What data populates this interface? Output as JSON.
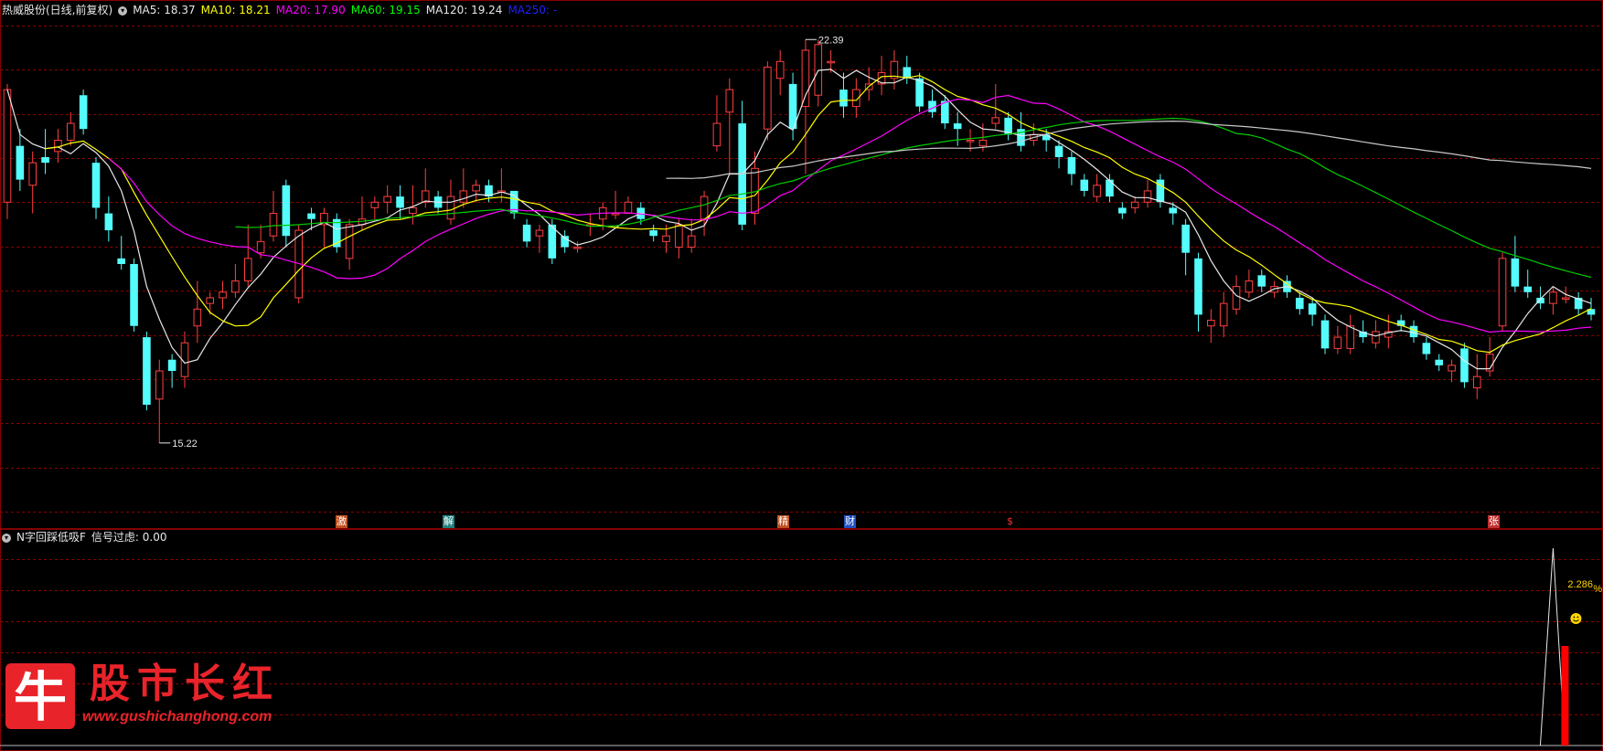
{
  "header": {
    "title": "热威股份(日线,前复权)",
    "ma_labels": [
      {
        "text": "MA5: 18.37",
        "color": "#e8e8e8"
      },
      {
        "text": "MA10: 18.21",
        "color": "#ffff00"
      },
      {
        "text": "MA20: 17.90",
        "color": "#ff00ff"
      },
      {
        "text": "MA60: 19.15",
        "color": "#00ff00"
      },
      {
        "text": "MA120: 19.24",
        "color": "#e8e8e8"
      },
      {
        "text": "MA250: -",
        "color": "#2020ff"
      }
    ]
  },
  "sub_header": {
    "indicator": "N字回踩低吸F",
    "signal_label": "信号过虑: 0.00"
  },
  "markers": {
    "high_price": "22.39",
    "low_price": "15.22",
    "indicator_value": "2.286",
    "indicator_unit": "%"
  },
  "event_tags": [
    {
      "text": "激",
      "bg": "#c05020",
      "color": "#ffffff"
    },
    {
      "text": "解",
      "bg": "#208080",
      "color": "#ffffff"
    },
    {
      "text": "精",
      "bg": "#c05020",
      "color": "#ffffff"
    },
    {
      "text": "财",
      "bg": "#2050c0",
      "color": "#ffffff"
    },
    {
      "text": "$",
      "bg": "#000000",
      "color": "#ff3030"
    },
    {
      "text": "张",
      "bg": "#c03030",
      "color": "#ffffff"
    }
  ],
  "logo": {
    "char": "牛",
    "title": "股市长红",
    "url": "www.gushichanghong.com"
  },
  "colors": {
    "up": "#ff4040",
    "down": "#54fcfc",
    "grid": "#8a0000",
    "ma5": "#e8e8e8",
    "ma10": "#ffff00",
    "ma20": "#ff00ff",
    "ma60": "#00cc00",
    "ma120": "#c8c8c8"
  },
  "chart_data": {
    "type": "candlestick",
    "price_range": [
      15.22,
      22.39
    ],
    "candles": [
      [
        19.5,
        21.5,
        21.6,
        19.2
      ],
      [
        20.5,
        19.9,
        20.8,
        19.7
      ],
      [
        19.8,
        20.2,
        20.4,
        19.3
      ],
      [
        20.3,
        20.2,
        20.8,
        20.0
      ],
      [
        20.4,
        20.6,
        20.8,
        20.2
      ],
      [
        20.6,
        20.9,
        21.1,
        20.5
      ],
      [
        21.4,
        20.8,
        21.5,
        20.7
      ],
      [
        20.2,
        19.4,
        20.3,
        19.2
      ],
      [
        19.3,
        19.0,
        19.6,
        18.8
      ],
      [
        18.5,
        18.4,
        18.9,
        18.3
      ],
      [
        18.4,
        17.3,
        18.5,
        17.2
      ],
      [
        17.1,
        15.9,
        17.2,
        15.8
      ],
      [
        16.0,
        16.5,
        16.7,
        15.22
      ],
      [
        16.7,
        16.5,
        16.8,
        16.2
      ],
      [
        16.4,
        17.0,
        17.2,
        16.2
      ],
      [
        17.3,
        17.6,
        18.1,
        17.0
      ],
      [
        17.7,
        17.8,
        17.9,
        17.5
      ],
      [
        17.8,
        17.9,
        18.1,
        17.6
      ],
      [
        17.9,
        18.1,
        18.4,
        17.8
      ],
      [
        18.1,
        18.5,
        19.1,
        18.0
      ],
      [
        18.6,
        18.8,
        19.1,
        18.5
      ],
      [
        18.9,
        19.3,
        19.7,
        18.8
      ],
      [
        19.8,
        18.9,
        19.9,
        18.7
      ],
      [
        17.8,
        19.0,
        19.1,
        17.7
      ],
      [
        19.3,
        19.2,
        19.4,
        19.0
      ],
      [
        19.1,
        19.3,
        19.4,
        18.7
      ],
      [
        19.2,
        18.7,
        19.3,
        18.6
      ],
      [
        18.5,
        19.1,
        19.2,
        18.3
      ],
      [
        19.1,
        19.2,
        19.6,
        19.0
      ],
      [
        19.4,
        19.5,
        19.6,
        19.2
      ],
      [
        19.5,
        19.6,
        19.8,
        19.3
      ],
      [
        19.6,
        19.4,
        19.8,
        19.2
      ],
      [
        19.3,
        19.4,
        19.8,
        19.1
      ],
      [
        19.5,
        19.7,
        20.1,
        19.4
      ],
      [
        19.6,
        19.4,
        19.7,
        19.3
      ],
      [
        19.2,
        19.6,
        19.9,
        19.1
      ],
      [
        19.5,
        19.7,
        20.1,
        19.4
      ],
      [
        19.7,
        19.8,
        19.9,
        19.5
      ],
      [
        19.8,
        19.6,
        19.9,
        19.5
      ],
      [
        19.7,
        19.7,
        20.1,
        19.5
      ],
      [
        19.7,
        19.3,
        19.7,
        19.2
      ],
      [
        19.1,
        18.8,
        19.2,
        18.7
      ],
      [
        18.9,
        19.0,
        19.1,
        18.6
      ],
      [
        19.1,
        18.5,
        19.2,
        18.4
      ],
      [
        18.9,
        18.7,
        19.0,
        18.6
      ],
      [
        18.7,
        18.7,
        18.8,
        18.6
      ],
      [
        19.1,
        19.1,
        19.3,
        18.9
      ],
      [
        19.2,
        19.4,
        19.5,
        19.0
      ],
      [
        19.3,
        19.3,
        19.7,
        19.2
      ],
      [
        19.3,
        19.5,
        19.6,
        19.3
      ],
      [
        19.4,
        19.2,
        19.5,
        19.1
      ],
      [
        19.0,
        18.9,
        19.1,
        18.8
      ],
      [
        18.8,
        18.9,
        19.1,
        18.6
      ],
      [
        18.7,
        19.1,
        19.2,
        18.5
      ],
      [
        18.7,
        18.9,
        19.2,
        18.6
      ],
      [
        19.2,
        19.6,
        19.7,
        18.9
      ],
      [
        20.5,
        20.9,
        21.4,
        20.4
      ],
      [
        21.1,
        21.5,
        21.7,
        20.0
      ],
      [
        20.9,
        19.1,
        21.3,
        19.0
      ],
      [
        19.3,
        20.1,
        20.4,
        19.1
      ],
      [
        20.8,
        21.9,
        22.0,
        20.6
      ],
      [
        21.7,
        22.0,
        22.2,
        21.4
      ],
      [
        21.6,
        20.8,
        21.8,
        20.6
      ],
      [
        21.2,
        22.2,
        22.39,
        20.0
      ],
      [
        21.4,
        22.3,
        22.39,
        21.2
      ],
      [
        22.0,
        22.0,
        22.2,
        21.8
      ],
      [
        21.5,
        21.2,
        21.8,
        21.0
      ],
      [
        21.2,
        21.5,
        21.7,
        21.0
      ],
      [
        21.5,
        21.6,
        21.9,
        21.3
      ],
      [
        21.6,
        21.8,
        22.1,
        21.4
      ],
      [
        21.7,
        22.0,
        22.2,
        21.5
      ],
      [
        21.9,
        21.7,
        22.1,
        21.6
      ],
      [
        21.7,
        21.2,
        21.8,
        21.1
      ],
      [
        21.3,
        21.1,
        21.5,
        21.0
      ],
      [
        21.3,
        20.9,
        21.4,
        20.8
      ],
      [
        20.9,
        20.8,
        21.1,
        20.5
      ],
      [
        20.6,
        20.6,
        20.8,
        20.4
      ],
      [
        20.5,
        20.6,
        20.9,
        20.4
      ],
      [
        20.9,
        21.0,
        21.6,
        20.8
      ],
      [
        21.0,
        20.7,
        21.1,
        20.6
      ],
      [
        20.8,
        20.5,
        21.1,
        20.4
      ],
      [
        20.6,
        20.7,
        20.9,
        20.5
      ],
      [
        20.7,
        20.6,
        20.8,
        20.4
      ],
      [
        20.5,
        20.3,
        20.6,
        20.1
      ],
      [
        20.3,
        20.0,
        20.4,
        19.8
      ],
      [
        19.9,
        19.7,
        20.0,
        19.6
      ],
      [
        19.6,
        19.8,
        20.0,
        19.5
      ],
      [
        19.9,
        19.6,
        20.0,
        19.5
      ],
      [
        19.4,
        19.3,
        19.5,
        19.2
      ],
      [
        19.4,
        19.5,
        19.6,
        19.3
      ],
      [
        19.5,
        19.7,
        19.9,
        19.4
      ],
      [
        19.9,
        19.5,
        20.0,
        19.4
      ],
      [
        19.4,
        19.3,
        19.5,
        19.1
      ],
      [
        19.1,
        18.6,
        19.2,
        18.2
      ],
      [
        18.5,
        17.5,
        18.6,
        17.2
      ],
      [
        17.3,
        17.4,
        17.6,
        17.0
      ],
      [
        17.3,
        17.7,
        17.9,
        17.1
      ],
      [
        17.6,
        18.0,
        18.2,
        17.5
      ],
      [
        17.9,
        18.1,
        18.3,
        17.8
      ],
      [
        18.2,
        18.0,
        18.3,
        17.9
      ],
      [
        17.9,
        18.0,
        18.1,
        17.8
      ],
      [
        18.1,
        17.9,
        18.2,
        17.8
      ],
      [
        17.8,
        17.6,
        17.9,
        17.5
      ],
      [
        17.7,
        17.5,
        17.8,
        17.3
      ],
      [
        17.4,
        16.9,
        17.5,
        16.8
      ],
      [
        16.9,
        17.1,
        17.3,
        16.8
      ],
      [
        16.9,
        17.3,
        17.5,
        16.8
      ],
      [
        17.2,
        17.1,
        17.4,
        17.0
      ],
      [
        17.0,
        17.2,
        17.4,
        16.9
      ],
      [
        17.1,
        17.2,
        17.5,
        16.9
      ],
      [
        17.4,
        17.3,
        17.5,
        17.2
      ],
      [
        17.3,
        17.1,
        17.4,
        17.0
      ],
      [
        17.0,
        16.8,
        17.1,
        16.7
      ],
      [
        16.7,
        16.6,
        16.8,
        16.5
      ],
      [
        16.5,
        16.6,
        16.7,
        16.3
      ],
      [
        16.9,
        16.3,
        17.0,
        16.2
      ],
      [
        16.2,
        16.4,
        16.8,
        16.0
      ],
      [
        16.5,
        16.8,
        17.1,
        16.4
      ],
      [
        17.3,
        18.5,
        18.6,
        17.2
      ],
      [
        18.5,
        18.0,
        18.9,
        17.9
      ],
      [
        18.0,
        17.9,
        18.3,
        17.8
      ],
      [
        17.8,
        17.7,
        18.0,
        17.6
      ],
      [
        17.7,
        17.9,
        18.0,
        17.5
      ],
      [
        17.8,
        17.8,
        18.0,
        17.7
      ],
      [
        17.8,
        17.6,
        17.9,
        17.5
      ],
      [
        17.6,
        17.5,
        17.8,
        17.4
      ]
    ],
    "indicator": {
      "name": "N字回踩低吸F",
      "signal_threshold": 0.0,
      "peak_value": 2.286,
      "unit": "%"
    }
  }
}
